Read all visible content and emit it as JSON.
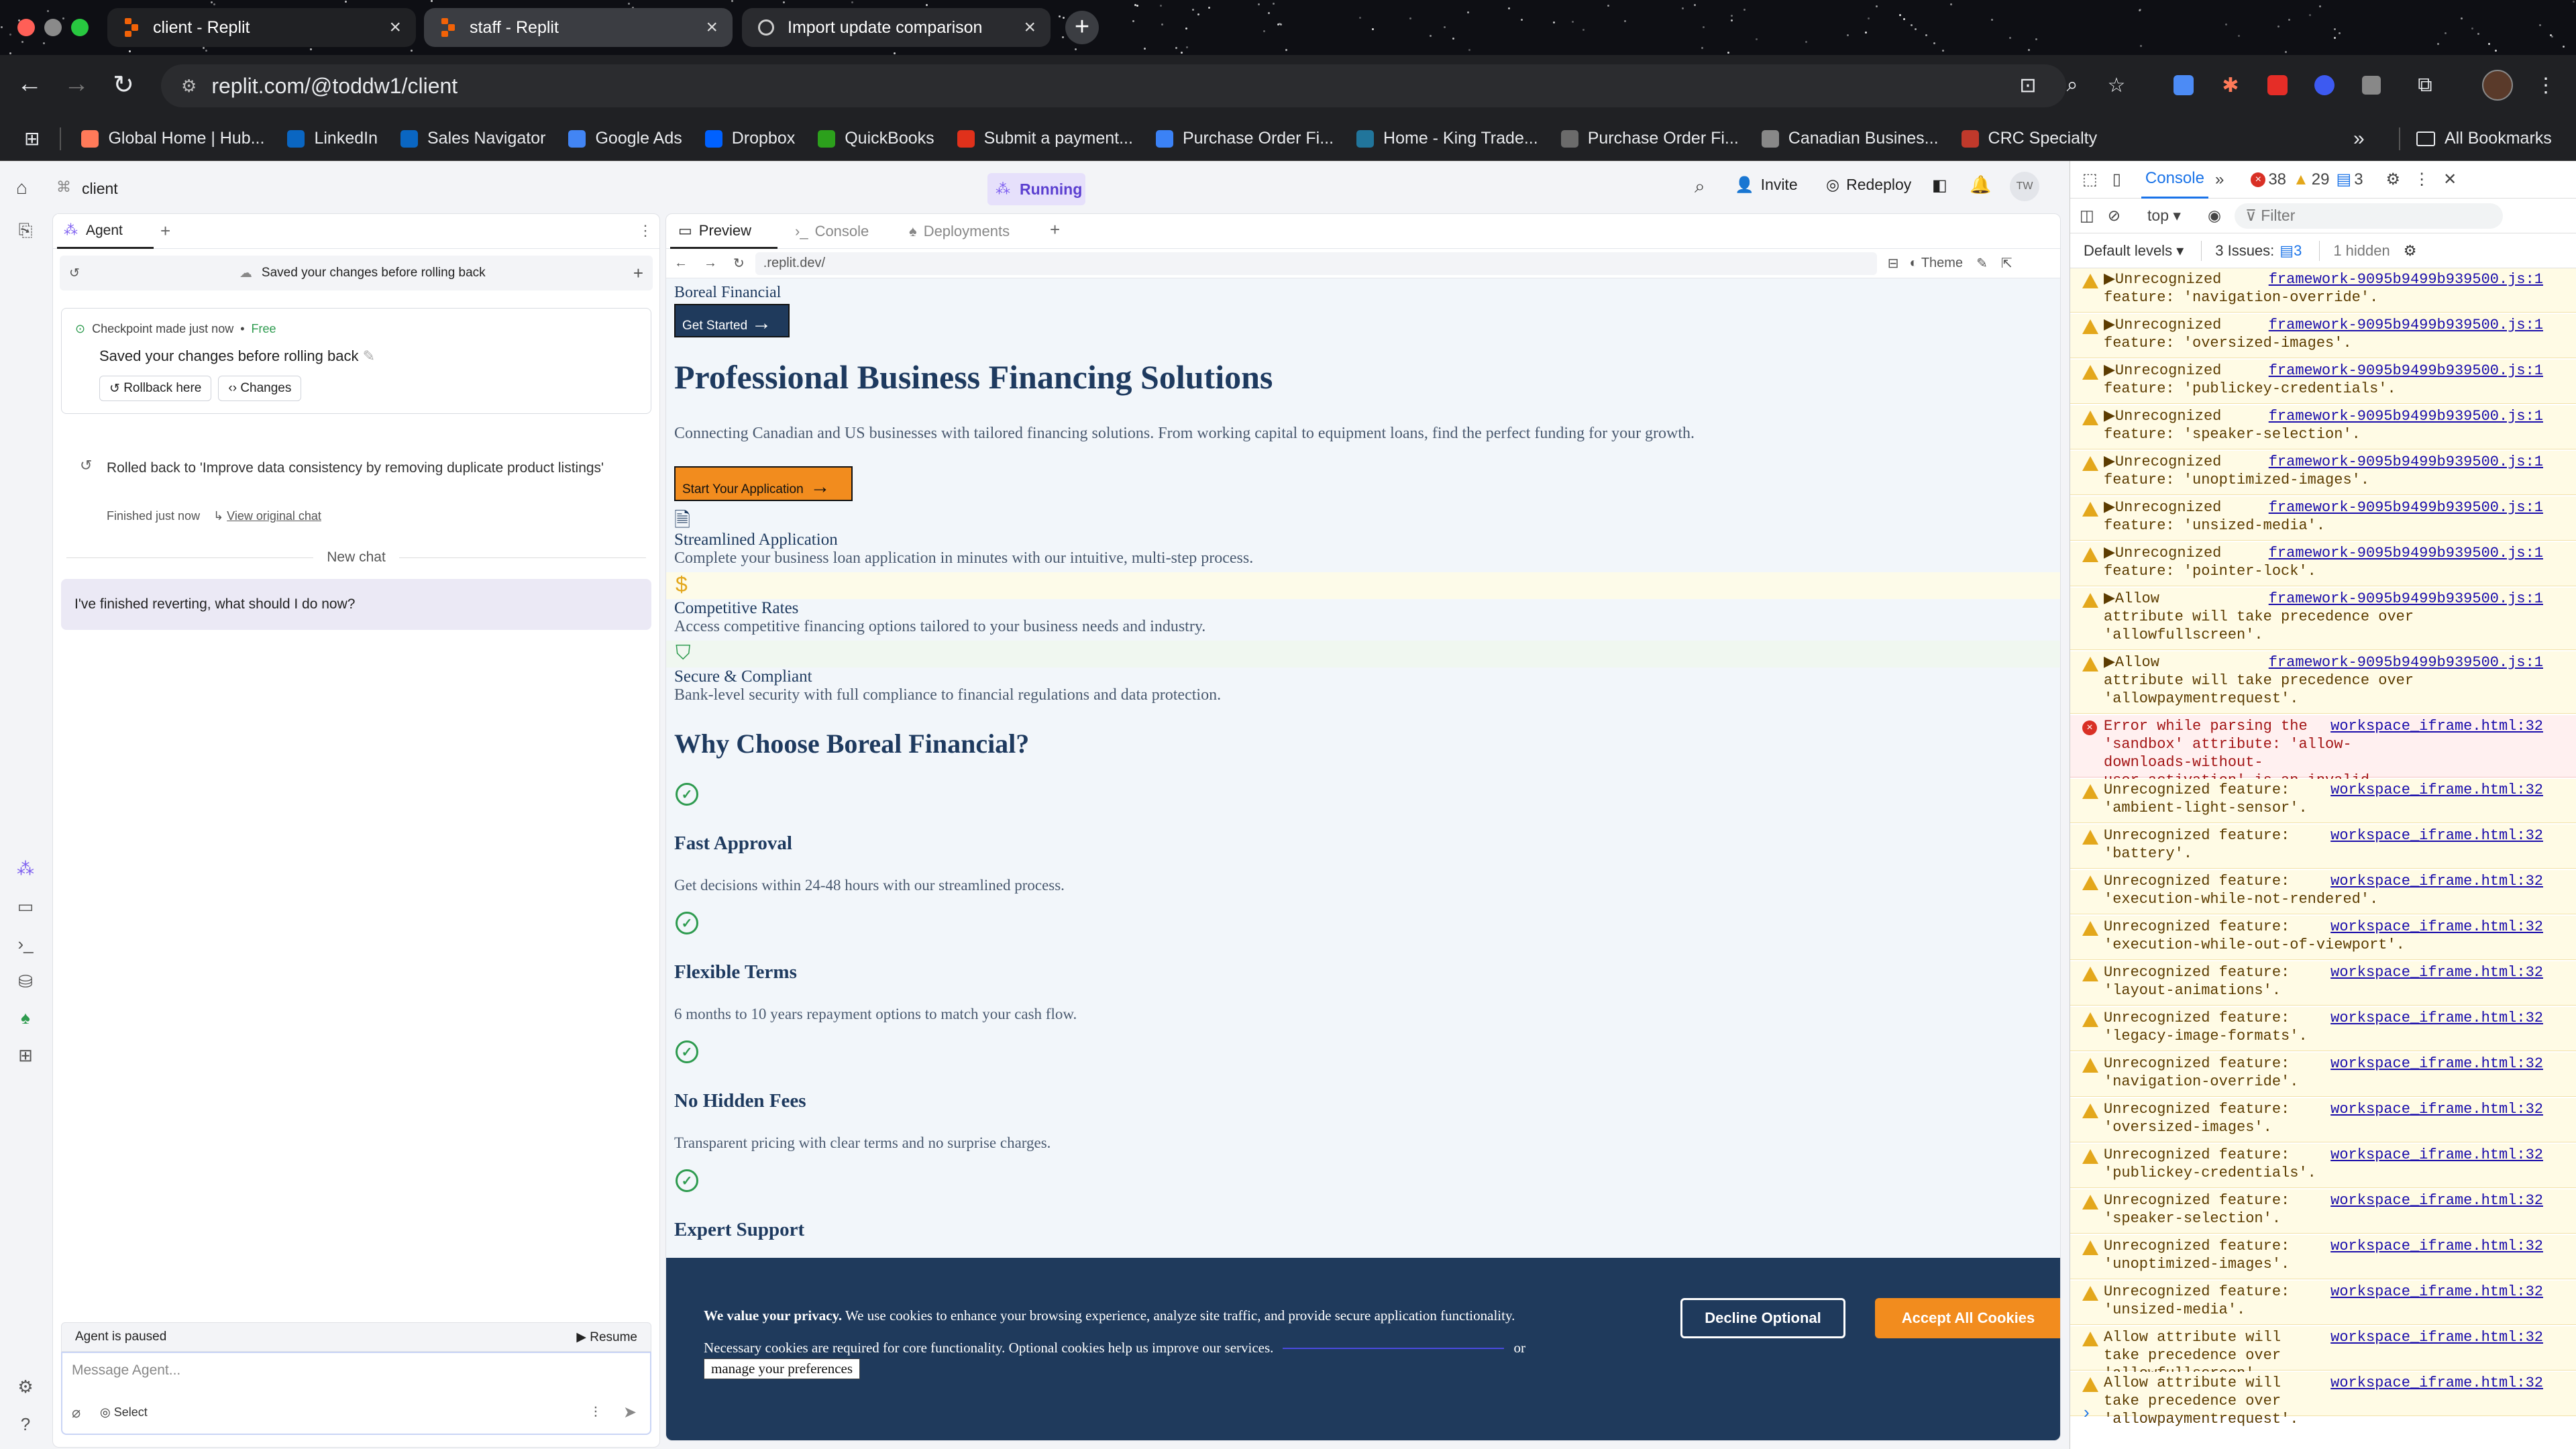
{
  "browser": {
    "tabs": [
      {
        "title": "client - Replit",
        "active": true
      },
      {
        "title": "staff - Replit",
        "active": false
      },
      {
        "title": "Import update comparison",
        "active": false
      }
    ],
    "url": "replit.com/@toddw1/client",
    "bookmarks": [
      "Global Home | Hub...",
      "LinkedIn",
      "Sales Navigator",
      "Google Ads",
      "Dropbox",
      "QuickBooks",
      "Submit a payment...",
      "Purchase Order Fi...",
      "Home - King Trade...",
      "Purchase Order Fi...",
      "Canadian Busines...",
      "CRC Specialty"
    ],
    "all_bookmarks": "All Bookmarks"
  },
  "replit": {
    "project": "client",
    "status": "Running",
    "invite": "Invite",
    "redeploy": "Redeploy",
    "avatar_initials": "TW",
    "agent": {
      "tab": "Agent",
      "header": "Saved your changes before rolling back",
      "checkpoint_label": "Checkpoint made just now",
      "checkpoint_price": "Free",
      "checkpoint_title": "Saved your changes before rolling back",
      "rollback_btn": "Rollback here",
      "changes_btn": "Changes",
      "rolled_back": "Rolled back to 'Improve data consistency by removing duplicate product listings'",
      "finished": "Finished just now",
      "view_original": "View original chat",
      "new_chat": "New chat",
      "message": "I've finished reverting, what should I do now?",
      "paused": "Agent is paused",
      "resume": "Resume",
      "placeholder": "Message Agent...",
      "select": "Select"
    },
    "preview": {
      "tabs": [
        "Preview",
        "Console",
        "Deployments"
      ],
      "url": ".replit.dev/",
      "theme": "Theme"
    }
  },
  "site": {
    "brand": "Boreal Financial",
    "get_started": "Get Started",
    "hero_title": "Professional Business Financing Solutions",
    "hero_sub": "Connecting Canadian and US businesses with tailored financing solutions. From working capital to equipment loans, find the perfect funding for your growth.",
    "cta": "Start Your Application",
    "features": [
      {
        "title": "Streamlined Application",
        "desc": "Complete your business loan application in minutes with our intuitive, multi-step process."
      },
      {
        "title": "Competitive Rates",
        "desc": "Access competitive financing options tailored to your business needs and industry."
      },
      {
        "title": "Secure & Compliant",
        "desc": "Bank-level security with full compliance to financial regulations and data protection."
      }
    ],
    "why_title": "Why Choose Boreal Financial?",
    "why": [
      {
        "title": "Fast Approval",
        "desc": "Get decisions within 24-48 hours with our streamlined process."
      },
      {
        "title": "Flexible Terms",
        "desc": "6 months to 10 years repayment options to match your cash flow."
      },
      {
        "title": "No Hidden Fees",
        "desc": "Transparent pricing with clear terms and no surprise charges."
      },
      {
        "title": "Expert Support",
        "desc": ""
      }
    ],
    "cookie": {
      "bold": "We value your privacy.",
      "text": " We use cookies to enhance your browsing experience, analyze site traffic, and provide secure application functionality.",
      "text2": "Necessary cookies are required for core functionality. Optional cookies help us improve our services.",
      "or": "or",
      "manage": "manage your preferences",
      "decline": "Decline Optional",
      "accept": "Accept All Cookies"
    }
  },
  "devtools": {
    "tab": "Console",
    "errors": "38",
    "warnings": "29",
    "info": "3",
    "context": "top",
    "filter": "Filter",
    "levels": "Default levels",
    "issues_label": "3 Issues:",
    "issues_count": "3",
    "hidden": "1 hidden",
    "messages": [
      {
        "type": "warn",
        "text": "▶Unrecognized\nfeature: 'navigation-override'.",
        "src": "framework-9095b9499b939500.js:1"
      },
      {
        "type": "warn",
        "text": "▶Unrecognized\nfeature: 'oversized-images'.",
        "src": "framework-9095b9499b939500.js:1"
      },
      {
        "type": "warn",
        "text": "▶Unrecognized\nfeature: 'publickey-credentials'.",
        "src": "framework-9095b9499b939500.js:1"
      },
      {
        "type": "warn",
        "text": "▶Unrecognized\nfeature: 'speaker-selection'.",
        "src": "framework-9095b9499b939500.js:1"
      },
      {
        "type": "warn",
        "text": "▶Unrecognized\nfeature: 'unoptimized-images'.",
        "src": "framework-9095b9499b939500.js:1"
      },
      {
        "type": "warn",
        "text": "▶Unrecognized\nfeature: 'unsized-media'.",
        "src": "framework-9095b9499b939500.js:1"
      },
      {
        "type": "warn",
        "text": "▶Unrecognized\nfeature: 'pointer-lock'.",
        "src": "framework-9095b9499b939500.js:1"
      },
      {
        "type": "warn",
        "text": "▶Allow\nattribute will take precedence over\n'allowfullscreen'.",
        "src": "framework-9095b9499b939500.js:1"
      },
      {
        "type": "warn",
        "text": "▶Allow\nattribute will take precedence over\n'allowpaymentrequest'.",
        "src": "framework-9095b9499b939500.js:1"
      },
      {
        "type": "err",
        "text": "Error while parsing the\n'sandbox' attribute: 'allow-downloads-without-\nuser-activation' is an invalid sandbox flag.",
        "src": "workspace_iframe.html:32"
      },
      {
        "type": "warn",
        "text": "Unrecognized feature:\n'ambient-light-sensor'.",
        "src": "workspace_iframe.html:32"
      },
      {
        "type": "warn",
        "text": "Unrecognized feature:\n'battery'.",
        "src": "workspace_iframe.html:32"
      },
      {
        "type": "warn",
        "text": "Unrecognized feature:\n'execution-while-not-rendered'.",
        "src": "workspace_iframe.html:32"
      },
      {
        "type": "warn",
        "text": "Unrecognized feature:\n'execution-while-out-of-viewport'.",
        "src": "workspace_iframe.html:32"
      },
      {
        "type": "warn",
        "text": "Unrecognized feature:\n'layout-animations'.",
        "src": "workspace_iframe.html:32"
      },
      {
        "type": "warn",
        "text": "Unrecognized feature:\n'legacy-image-formats'.",
        "src": "workspace_iframe.html:32"
      },
      {
        "type": "warn",
        "text": "Unrecognized feature:\n'navigation-override'.",
        "src": "workspace_iframe.html:32"
      },
      {
        "type": "warn",
        "text": "Unrecognized feature:\n'oversized-images'.",
        "src": "workspace_iframe.html:32"
      },
      {
        "type": "warn",
        "text": "Unrecognized feature:\n'publickey-credentials'.",
        "src": "workspace_iframe.html:32"
      },
      {
        "type": "warn",
        "text": "Unrecognized feature:\n'speaker-selection'.",
        "src": "workspace_iframe.html:32"
      },
      {
        "type": "warn",
        "text": "Unrecognized feature:\n'unoptimized-images'.",
        "src": "workspace_iframe.html:32"
      },
      {
        "type": "warn",
        "text": "Unrecognized feature:\n'unsized-media'.",
        "src": "workspace_iframe.html:32"
      },
      {
        "type": "warn",
        "text": "Allow attribute will\ntake precedence over 'allowfullscreen'.",
        "src": "workspace_iframe.html:32"
      },
      {
        "type": "warn",
        "text": "Allow attribute will\ntake precedence over 'allowpaymentrequest'.",
        "src": "workspace_iframe.html:32"
      }
    ]
  }
}
